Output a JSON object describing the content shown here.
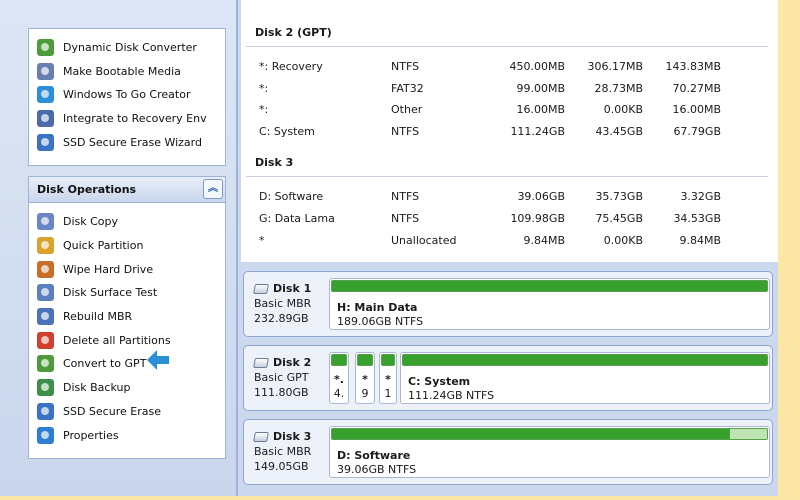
{
  "sidebar": {
    "wizards": [
      {
        "label": "Dynamic Disk Converter",
        "icon": "dynamic-disk-icon",
        "color": "#4f9a3a"
      },
      {
        "label": "Make Bootable Media",
        "icon": "bootable-media-icon",
        "color": "#6a7fb0"
      },
      {
        "label": "Windows To Go Creator",
        "icon": "windows-to-go-icon",
        "color": "#2d8fd8"
      },
      {
        "label": "Integrate to Recovery Env",
        "icon": "recovery-env-icon",
        "color": "#4d6aa8"
      },
      {
        "label": "SSD Secure Erase Wizard",
        "icon": "ssd-erase-wizard-icon",
        "color": "#3b73c4"
      }
    ],
    "operations": {
      "title": "Disk Operations",
      "collapse_glyph": "︽",
      "items": [
        {
          "label": "Disk Copy",
          "icon": "disk-copy-icon",
          "color": "#6a86c4"
        },
        {
          "label": "Quick Partition",
          "icon": "quick-partition-icon",
          "color": "#d9a22c"
        },
        {
          "label": "Wipe Hard Drive",
          "icon": "wipe-drive-icon",
          "color": "#c96f2a"
        },
        {
          "label": "Disk Surface Test",
          "icon": "surface-test-icon",
          "color": "#5d7fbf"
        },
        {
          "label": "Rebuild MBR",
          "icon": "rebuild-mbr-icon",
          "color": "#4c72b8"
        },
        {
          "label": "Delete all Partitions",
          "icon": "delete-partitions-icon",
          "color": "#d0402f"
        },
        {
          "label": "Convert to GPT",
          "icon": "convert-gpt-icon",
          "color": "#4f9a3a"
        },
        {
          "label": "Disk Backup",
          "icon": "disk-backup-icon",
          "color": "#3b8f4a"
        },
        {
          "label": "SSD Secure Erase",
          "icon": "ssd-erase-icon",
          "color": "#3b73c4"
        },
        {
          "label": "Properties",
          "icon": "properties-icon",
          "color": "#2f7fd0"
        }
      ]
    }
  },
  "partition_list": {
    "disks": [
      {
        "title": "Disk 2 (GPT)",
        "rows": [
          {
            "name": "*: Recovery",
            "fs": "NTFS",
            "capacity": "450.00MB",
            "used": "306.17MB",
            "free": "143.83MB"
          },
          {
            "name": "*:",
            "fs": "FAT32",
            "capacity": "99.00MB",
            "used": "28.73MB",
            "free": "70.27MB"
          },
          {
            "name": "*:",
            "fs": "Other",
            "capacity": "16.00MB",
            "used": "0.00KB",
            "free": "16.00MB"
          },
          {
            "name": "C: System",
            "fs": "NTFS",
            "capacity": "111.24GB",
            "used": "43.45GB",
            "free": "67.79GB"
          }
        ]
      },
      {
        "title": "Disk 3",
        "rows": [
          {
            "name": "D: Software",
            "fs": "NTFS",
            "capacity": "39.06GB",
            "used": "35.73GB",
            "free": "3.32GB"
          },
          {
            "name": "G: Data Lama",
            "fs": "NTFS",
            "capacity": "109.98GB",
            "used": "75.45GB",
            "free": "34.53GB"
          },
          {
            "name": "*",
            "fs": "Unallocated",
            "capacity": "9.84MB",
            "used": "0.00KB",
            "free": "9.84MB"
          }
        ]
      }
    ]
  },
  "disk_map": [
    {
      "name": "Disk 1",
      "type": "Basic MBR",
      "size": "232.89GB",
      "partitions": [
        {
          "label": "H: Main Data",
          "detail": "189.06GB NTFS",
          "used_fraction": 1.0
        }
      ]
    },
    {
      "name": "Disk 2",
      "type": "Basic GPT",
      "size": "111.80GB",
      "partitions": [
        {
          "label": "*.",
          "detail": "4.",
          "used_fraction": 1.0
        },
        {
          "label": "*",
          "detail": "9",
          "used_fraction": 1.0
        },
        {
          "label": "*",
          "detail": "1",
          "used_fraction": 1.0
        },
        {
          "label": "C: System",
          "detail": "111.24GB NTFS",
          "used_fraction": 1.0
        }
      ]
    },
    {
      "name": "Disk 3",
      "type": "Basic MBR",
      "size": "149.05GB",
      "partitions": [
        {
          "label": "D: Software",
          "detail": "39.06GB NTFS",
          "used_fraction": 0.915
        }
      ]
    }
  ],
  "colors": {
    "page_background": "#fde7a6",
    "used_green": "#38a12d",
    "free_green": "#bfe4b4",
    "accent_blue": "#2b8fd8"
  }
}
